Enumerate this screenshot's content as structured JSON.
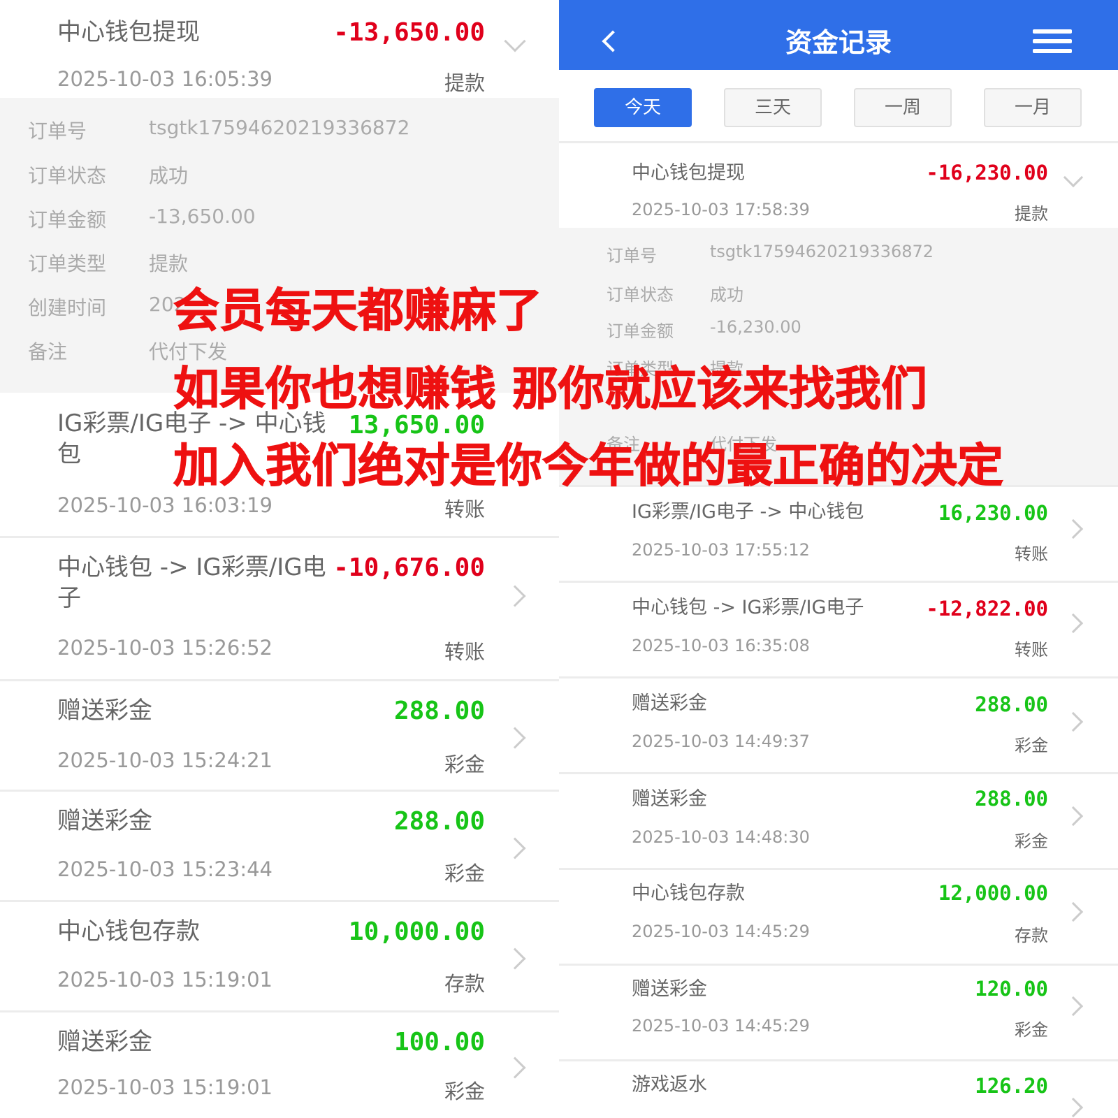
{
  "left": {
    "expanded": {
      "title": "中心钱包提现",
      "amount": "-13,650.00",
      "amount_color": "#e0001b",
      "time": "2025-10-03 16:05:39",
      "type": "提款",
      "details": [
        {
          "label": "订单号",
          "value": "tsgtk17594620219336872"
        },
        {
          "label": "订单状态",
          "value": "成功"
        },
        {
          "label": "订单金额",
          "value": "-13,650.00"
        },
        {
          "label": "订单类型",
          "value": "提款"
        },
        {
          "label": "创建时间",
          "value": "202"
        },
        {
          "label": "备注",
          "value": "代付下发"
        }
      ]
    },
    "records": [
      {
        "title": "IG彩票/IG电子 -> 中心钱包",
        "amount": "13,650.00",
        "color": "green",
        "time": "2025-10-03 16:03:19",
        "type": "转账"
      },
      {
        "title": "中心钱包 -> IG彩票/IG电子",
        "amount": "-10,676.00",
        "color": "red",
        "time": "2025-10-03 15:26:52",
        "type": "转账"
      },
      {
        "title": "赠送彩金",
        "amount": "288.00",
        "color": "green",
        "time": "2025-10-03 15:24:21",
        "type": "彩金"
      },
      {
        "title": "赠送彩金",
        "amount": "288.00",
        "color": "green",
        "time": "2025-10-03 15:23:44",
        "type": "彩金"
      },
      {
        "title": "中心钱包存款",
        "amount": "10,000.00",
        "color": "green",
        "time": "2025-10-03 15:19:01",
        "type": "存款"
      },
      {
        "title": "赠送彩金",
        "amount": "100.00",
        "color": "green",
        "time": "2025-10-03 15:19:01",
        "type": "彩金"
      }
    ]
  },
  "right": {
    "header": {
      "title": "资金记录",
      "back_icon": "back-icon",
      "menu_icon": "menu-icon",
      "color": "#2f6fe8"
    },
    "tabs": [
      {
        "label": "今天",
        "active": true
      },
      {
        "label": "三天",
        "active": false
      },
      {
        "label": "一周",
        "active": false
      },
      {
        "label": "一月",
        "active": false
      }
    ],
    "expanded": {
      "title": "中心钱包提现",
      "amount": "-16,230.00",
      "time": "2025-10-03 17:58:39",
      "type": "提款",
      "details": [
        {
          "label": "订单号",
          "value": "tsgtk17594620219336872"
        },
        {
          "label": "订单状态",
          "value": "成功"
        },
        {
          "label": "订单金额",
          "value": "-16,230.00"
        },
        {
          "label": "订单类型",
          "value": "提款"
        },
        {
          "label": "",
          "value": ""
        },
        {
          "label": "备注",
          "value": "代付下发"
        }
      ]
    },
    "records": [
      {
        "title": "IG彩票/IG电子 -> 中心钱包",
        "amount": "16,230.00",
        "color": "green",
        "time": "2025-10-03 17:55:12",
        "type": "转账"
      },
      {
        "title": "中心钱包 -> IG彩票/IG电子",
        "amount": "-12,822.00",
        "color": "red",
        "time": "2025-10-03 16:35:08",
        "type": "转账"
      },
      {
        "title": "赠送彩金",
        "amount": "288.00",
        "color": "green",
        "time": "2025-10-03 14:49:37",
        "type": "彩金"
      },
      {
        "title": "赠送彩金",
        "amount": "288.00",
        "color": "green",
        "time": "2025-10-03 14:48:30",
        "type": "彩金"
      },
      {
        "title": "中心钱包存款",
        "amount": "12,000.00",
        "color": "green",
        "time": "2025-10-03 14:45:29",
        "type": "存款"
      },
      {
        "title": "赠送彩金",
        "amount": "120.00",
        "color": "green",
        "time": "2025-10-03 14:45:29",
        "type": "彩金"
      },
      {
        "title": "游戏返水",
        "amount": "126.20",
        "color": "green",
        "time": "",
        "type": ""
      }
    ]
  },
  "overlay": {
    "lines": [
      "会员每天都赚麻了",
      "如果你也想赚钱 那你就应该来找我们",
      "加入我们绝对是你今年做的最正确的决定"
    ],
    "color": "#ee1111"
  }
}
